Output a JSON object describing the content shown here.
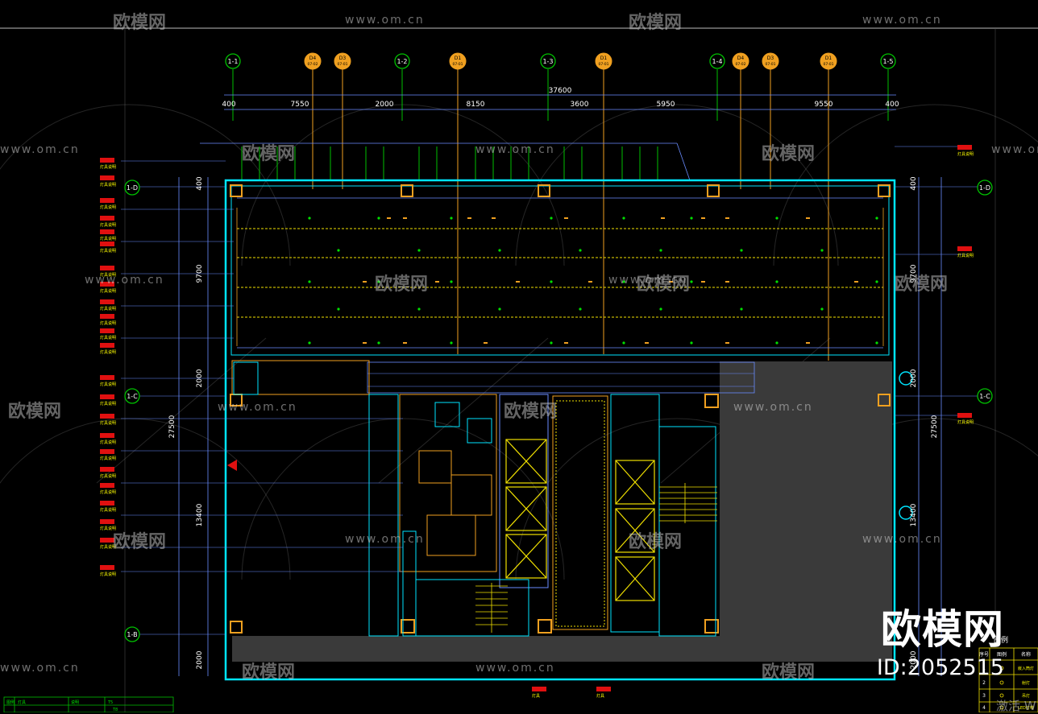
{
  "watermark": {
    "brand_large": "欧模网",
    "id_label": "ID:2052515",
    "site": "www.om.cn",
    "brand": "欧模网",
    "bottom_right_partial": "激活 W"
  },
  "drawing": {
    "top_grid_labels": [
      "1-1",
      "D4\n07-02",
      "D3\n07-01",
      "1-2",
      "D1\n07-01",
      "1-3",
      "D1\n07-01",
      "1-4",
      "D4\n07-02",
      "D3\n07-01",
      "D1\n07-01",
      "1-5"
    ],
    "overall_dim": "37600",
    "top_dims": [
      "400",
      "7550",
      "2000",
      "8150",
      "3600",
      "5950",
      "9550",
      "400"
    ],
    "left_grid_labels": [
      "1-D",
      "1-C",
      "1-B"
    ],
    "right_grid_labels": [
      "1-D",
      "1-C"
    ],
    "left_dims": [
      "400",
      "9700",
      "2000",
      "13400",
      "2000",
      "27500"
    ],
    "right_dims": [
      "400",
      "9700",
      "2000",
      "13400",
      "27500",
      "2000"
    ],
    "legend_title": "图例",
    "legend_rows": [
      {
        "no": "1",
        "name": "嵌入筒灯"
      },
      {
        "no": "2",
        "name": "射灯"
      },
      {
        "no": "3",
        "name": "吊灯"
      },
      {
        "no": "4",
        "name": "LED灯带"
      }
    ],
    "legend_header": [
      "序号",
      "图例",
      "名称"
    ],
    "bottom_left_table": [
      "图例",
      "灯具",
      "说明",
      "T5",
      "T8"
    ],
    "red_tag_label": "灯具",
    "yellow_tag_label": "灯具说明"
  },
  "colors": {
    "background": "#000000",
    "wall_cyan": "#00e5ff",
    "grid_green": "#00c000",
    "dim_blue": "#6a8cff",
    "orange": "#f0a020",
    "yellow": "#f0e000",
    "red": "#e01010",
    "gray_fill": "#3a3a3a"
  }
}
